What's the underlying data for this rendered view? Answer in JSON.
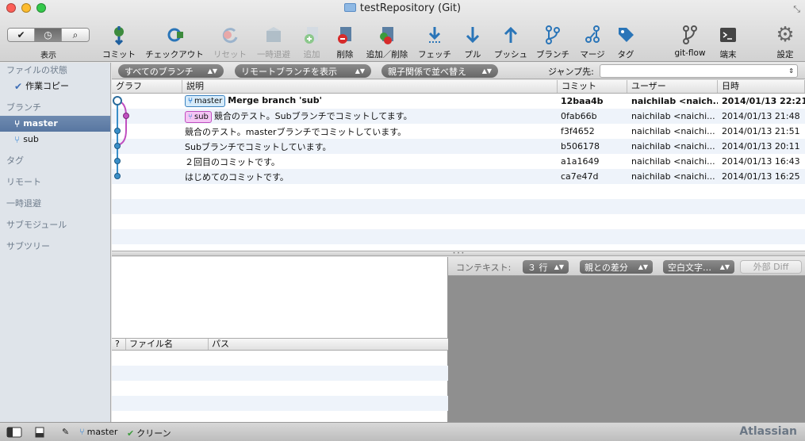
{
  "window": {
    "title": "testRepository (Git)"
  },
  "toolbar": {
    "view_label": "表示",
    "buttons": [
      {
        "label": "コミット",
        "icon": "commit-icon"
      },
      {
        "label": "チェックアウト",
        "icon": "checkout-icon"
      },
      {
        "label": "リセット",
        "icon": "reset-icon"
      },
      {
        "label": "一時退避",
        "icon": "stash-icon"
      },
      {
        "label": "追加",
        "icon": "add-icon"
      },
      {
        "label": "削除",
        "icon": "remove-icon"
      },
      {
        "label": "追加／削除",
        "icon": "add-remove-icon"
      },
      {
        "label": "フェッチ",
        "icon": "fetch-icon"
      },
      {
        "label": "プル",
        "icon": "pull-icon"
      },
      {
        "label": "プッシュ",
        "icon": "push-icon"
      },
      {
        "label": "ブランチ",
        "icon": "branch-icon"
      },
      {
        "label": "マージ",
        "icon": "merge-icon"
      },
      {
        "label": "タグ",
        "icon": "tag-icon"
      },
      {
        "label": "git-flow",
        "icon": "git-flow-icon"
      },
      {
        "label": "端末",
        "icon": "terminal-icon"
      },
      {
        "label": "設定",
        "icon": "settings-icon"
      }
    ]
  },
  "sidebar": {
    "file_status_header": "ファイルの状態",
    "working_copy": "作業コピー",
    "branches_header": "ブランチ",
    "branches": [
      "master",
      "sub"
    ],
    "tags_header": "タグ",
    "remotes_header": "リモート",
    "stashes_header": "一時退避",
    "submodules_header": "サブモジュール",
    "subtrees_header": "サブツリー"
  },
  "filters": {
    "branches": "すべてのブランチ",
    "remote": "リモートブランチを表示",
    "sort": "親子関係で並べ替え",
    "jump_label": "ジャンプ先:",
    "jump_arrow": "⇕"
  },
  "commit_table": {
    "headers": {
      "graph": "グラフ",
      "description": "説明",
      "commit": "コミット",
      "user": "ユーザー",
      "date": "日時"
    },
    "rows": [
      {
        "tag": "master",
        "description": "Merge branch 'sub'",
        "commit": "12baa4b",
        "user": "naichilab <naich...",
        "date": "2014/01/13 22:21"
      },
      {
        "tag": "sub",
        "description": "競合のテスト。Subブランチでコミットしてます。",
        "commit": "0fab66b",
        "user": "naichilab <naichi...",
        "date": "2014/01/13 21:48"
      },
      {
        "tag": "",
        "description": "競合のテスト。masterブランチでコミットしています。",
        "commit": "f3f4652",
        "user": "naichilab <naichi...",
        "date": "2014/01/13 21:51"
      },
      {
        "tag": "",
        "description": "Subブランチでコミットしています。",
        "commit": "b506178",
        "user": "naichilab <naichi...",
        "date": "2014/01/13 20:11"
      },
      {
        "tag": "",
        "description": "２回目のコミットです。",
        "commit": "a1a1649",
        "user": "naichilab <naichi...",
        "date": "2014/01/13 16:43"
      },
      {
        "tag": "",
        "description": "はじめてのコミットです。",
        "commit": "ca7e47d",
        "user": "naichilab <naichi...",
        "date": "2014/01/13 16:25"
      }
    ]
  },
  "file_list": {
    "headers": {
      "status": "?",
      "filename": "ファイル名",
      "path": "パス"
    }
  },
  "diff": {
    "context_label": "コンテキスト:",
    "context_lines": "３ 行",
    "diff_mode": "親との差分",
    "whitespace": "空白文字…",
    "external_diff": "外部 Diff"
  },
  "status_bar": {
    "branch": "master",
    "state": "クリーン",
    "brand": "Atlassian"
  },
  "colors": {
    "master_branch": "#2e82d6",
    "sub_branch": "#c04fc0",
    "selection": "#5877a1"
  }
}
